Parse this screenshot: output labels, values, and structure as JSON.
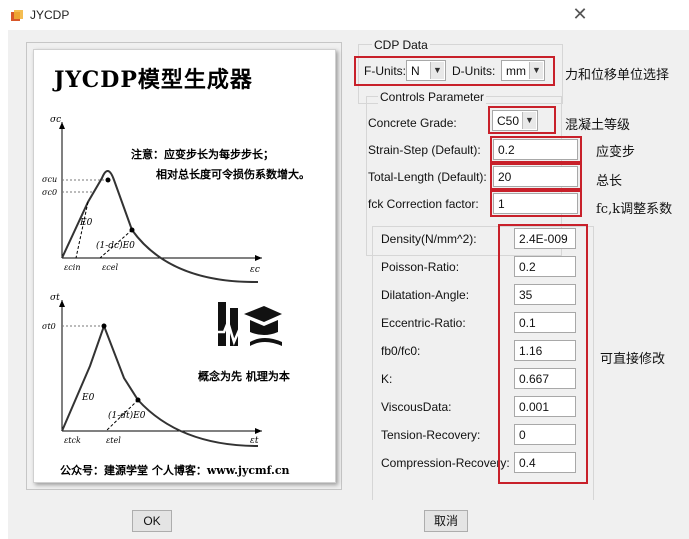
{
  "window": {
    "title": "JYCDP",
    "close_glyph": "✕"
  },
  "info": {
    "title": "JYCDP模型生成器",
    "note_line1": "注意：应变步长为每步步长；",
    "note_line2": "相对总长度可令损伤系数增大。",
    "motto": "概念为先 机理为本",
    "footer": "公众号：建源学堂   个人博客：www.jycmf.cn",
    "chart1": {
      "y_axis": "σc",
      "y_tick1": "σcu",
      "y_tick2": "σc0",
      "x_axis": "εc",
      "x_tick1": "εcin",
      "x_tick2": "εcel",
      "slope": "E0",
      "damage_slope": "(1-dc)E0"
    },
    "chart2": {
      "y_axis": "σt",
      "y_tick1": "σt0",
      "x_axis": "εt",
      "x_tick1": "εtck",
      "x_tick2": "εtel",
      "slope": "E0",
      "damage_slope": "(1-dt)E0"
    }
  },
  "cdp_data": {
    "legend": "CDP Data",
    "f_units_label": "F-Units:",
    "f_units_value": "N",
    "d_units_label": "D-Units:",
    "d_units_value": "mm"
  },
  "controls": {
    "legend": "Controls Parameter",
    "concrete_grade_label": "Concrete Grade:",
    "concrete_grade_value": "C50",
    "strain_step_label": "Strain-Step (Default):",
    "strain_step_value": "0.2",
    "total_length_label": "Total-Length (Default):",
    "total_length_value": "20",
    "fck_label": "fck Correction factor:",
    "fck_value": "1"
  },
  "params": [
    {
      "label": "Density(N/mm^2):",
      "value": "2.4E-009"
    },
    {
      "label": "Poisson-Ratio:",
      "value": "0.2"
    },
    {
      "label": "Dilatation-Angle:",
      "value": "35"
    },
    {
      "label": "Eccentric-Ratio:",
      "value": "0.1"
    },
    {
      "label": "fb0/fc0:",
      "value": "1.16"
    },
    {
      "label": "K:",
      "value": "0.667"
    },
    {
      "label": "ViscousData:",
      "value": "0.001"
    },
    {
      "label": "Tension-Recovery:",
      "value": "0"
    },
    {
      "label": "Compression-Recovery:",
      "value": "0.4"
    }
  ],
  "annotations": {
    "units": "力和位移单位选择",
    "grade": "混凝土等级",
    "step": "应变步",
    "length": "总长",
    "fck": "fc,k调整系数",
    "editable": "可直接修改"
  },
  "buttons": {
    "ok": "OK",
    "cancel": "取消"
  },
  "colors": {
    "highlight": "#c8202a",
    "window_bg": "#f0f0f0"
  }
}
